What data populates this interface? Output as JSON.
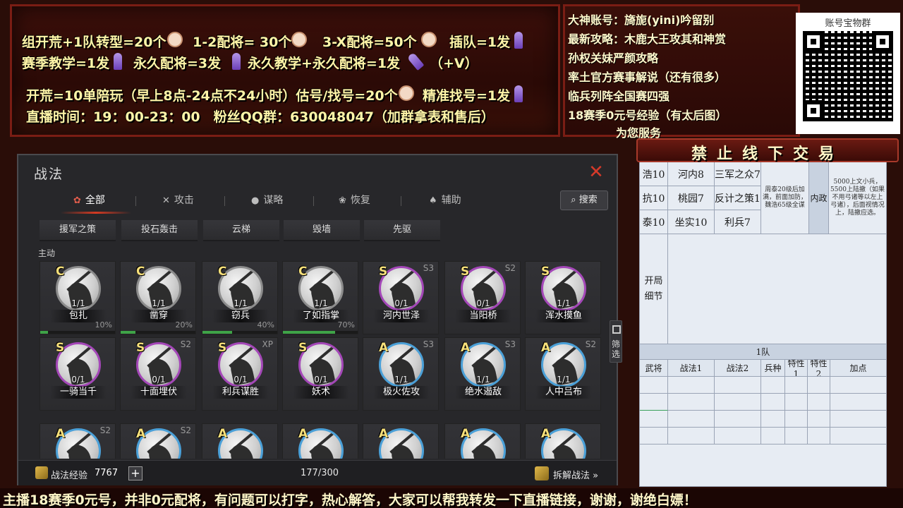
{
  "banner": {
    "line1": {
      "a": "组开荒+1队转型=20个",
      "b": "1-2配将= 30个",
      "c": "3-X配将=50个",
      "d": "插队=1发"
    },
    "line2": {
      "a": "赛季教学=1发",
      "b": "永久配将=3发",
      "c": "永久教学+永久配将=1发",
      "d": "（+V）"
    },
    "line3": "开荒=10单陪玩（早上8点-24点不24小时）估号/找号=20个",
    "line3b": "精准找号=1发",
    "line4": "直播时间：19：00-23：00　粉丝QQ群：630048047（加群拿表和售后）"
  },
  "notice": {
    "lines": [
      "大神账号：旖旎(yini)吟留别",
      "最新攻略：木鹿大王攻其和神赏",
      "孙权关妹严颜攻略",
      "率土官方赛事解说（还有很多）",
      "临兵列阵全国赛四强",
      "18赛季0元号经验（有太后图）",
      "为您服务"
    ]
  },
  "qr": {
    "title": "账号宝物群"
  },
  "panel": {
    "title": "战法",
    "tabs": [
      {
        "label": "全部",
        "icon": "all-icon"
      },
      {
        "label": "攻击",
        "icon": "sword-icon"
      },
      {
        "label": "谋略",
        "icon": "brain-icon"
      },
      {
        "label": "恢复",
        "icon": "heal-icon"
      },
      {
        "label": "辅助",
        "icon": "assist-icon"
      }
    ],
    "search_label": "搜索",
    "top_row": [
      "援军之策",
      "投石轰击",
      "云梯",
      "毁墙",
      "先驱"
    ],
    "section": "主动",
    "cards_row1": [
      {
        "grade": "C",
        "name": "包扎",
        "count": "1/1",
        "badge": "",
        "progress": 10,
        "pct": "10%"
      },
      {
        "grade": "C",
        "name": "凿穿",
        "count": "1/1",
        "badge": "",
        "progress": 20,
        "pct": "20%"
      },
      {
        "grade": "C",
        "name": "窃兵",
        "count": "1/1",
        "badge": "",
        "progress": 40,
        "pct": "40%"
      },
      {
        "grade": "C",
        "name": "了如指掌",
        "count": "1/1",
        "badge": "",
        "progress": 70,
        "pct": "70%"
      },
      {
        "grade": "S",
        "name": "河内世泽",
        "count": "0/1",
        "badge": "S3",
        "progress": null,
        "pct": ""
      },
      {
        "grade": "S",
        "name": "当阳桥",
        "count": "0/1",
        "badge": "S2",
        "progress": null,
        "pct": ""
      },
      {
        "grade": "S",
        "name": "浑水摸鱼",
        "count": "1/1",
        "badge": "",
        "progress": null,
        "pct": ""
      }
    ],
    "cards_row2": [
      {
        "grade": "S",
        "name": "一骑当千",
        "count": "0/1",
        "badge": ""
      },
      {
        "grade": "S",
        "name": "十面埋伏",
        "count": "0/1",
        "badge": "S2"
      },
      {
        "grade": "S",
        "name": "利兵谋胜",
        "count": "0/1",
        "badge": "XP"
      },
      {
        "grade": "S",
        "name": "妖术",
        "count": "0/1",
        "badge": ""
      },
      {
        "grade": "A",
        "name": "极火佐攻",
        "count": "1/1",
        "badge": "S3"
      },
      {
        "grade": "A",
        "name": "绝水遏敌",
        "count": "1/1",
        "badge": "S3"
      },
      {
        "grade": "A",
        "name": "人中吕布",
        "count": "1/1",
        "badge": "S2"
      }
    ],
    "cards_row3": [
      {
        "grade": "A",
        "badge": "S2"
      },
      {
        "grade": "A",
        "badge": "S2"
      },
      {
        "grade": "A",
        "badge": ""
      },
      {
        "grade": "A",
        "badge": ""
      },
      {
        "grade": "A",
        "badge": ""
      },
      {
        "grade": "A",
        "badge": ""
      },
      {
        "grade": "A",
        "badge": ""
      }
    ],
    "filter_label": "筛选",
    "exp_label": "战法经验",
    "exp_value": "7767",
    "slots": "177/300",
    "dismantle_label": "拆解战法 »"
  },
  "notice2": "禁止线下交易",
  "sheet": {
    "r1": [
      "浩10",
      "河内8",
      "三军之众7"
    ],
    "r2": [
      "抗10",
      "桃园7",
      "反计之策1"
    ],
    "r3": [
      "泰10",
      "坐实10",
      "利兵7"
    ],
    "note_left": "周泰20级后加满，前面加防，魏浩65级全谋",
    "note_mid": "内政",
    "note_right": "5000上文小兵，5500上陆撤（如果不用弓诸等以左上弓诸），后面视情况上，陆撤应选。",
    "side_label": "开局细节",
    "team": "1队",
    "headers": [
      "武将",
      "战法1",
      "战法2",
      "兵种",
      "特性1",
      "特性2",
      "加点"
    ]
  },
  "ticker": "主播18赛季0元号，并非0元配将，有问题可以打字，热心解答，大家可以帮我转发一下直播链接，谢谢，谢绝白嫖！"
}
